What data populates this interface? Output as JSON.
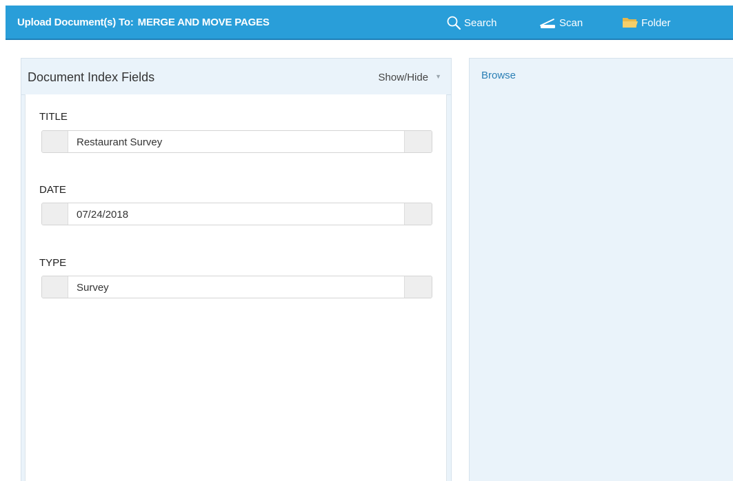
{
  "header": {
    "title_prefix": "Upload Document(s) To:",
    "title_target": "MERGE AND MOVE PAGES",
    "background_color": "#299ed9",
    "tools": [
      {
        "label": "Search",
        "icon": "search-icon"
      },
      {
        "label": "Scan",
        "icon": "scanner-icon"
      },
      {
        "label": "Folder",
        "icon": "folder-icon"
      }
    ]
  },
  "index_panel": {
    "title": "Document Index Fields",
    "show_hide_label": "Show/Hide",
    "fields": [
      {
        "label": "TITLE",
        "value": "Restaurant Survey"
      },
      {
        "label": "DATE",
        "value": "07/24/2018"
      },
      {
        "label": "TYPE",
        "value": "Survey"
      }
    ]
  },
  "browse_panel": {
    "browse_label": "Browse",
    "background_color": "#eaf3fa"
  }
}
